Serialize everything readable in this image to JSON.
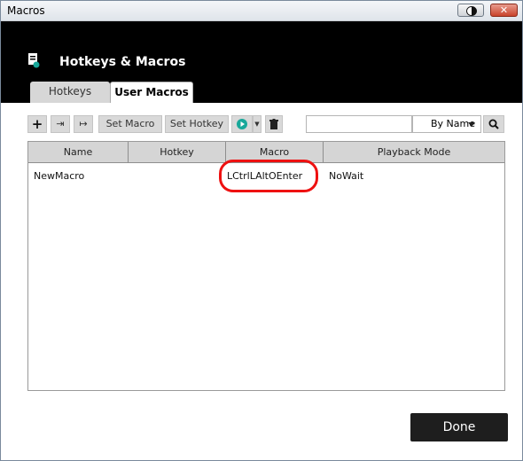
{
  "window": {
    "title": "Macros"
  },
  "header": {
    "title": "Hotkeys & Macros"
  },
  "tabs": [
    {
      "label": "Hotkeys",
      "active": false
    },
    {
      "label": "User Macros",
      "active": true
    }
  ],
  "toolbar": {
    "set_macro_label": "Set Macro",
    "set_hotkey_label": "Set Hotkey",
    "search_value": "",
    "sort_value": "By Name"
  },
  "table": {
    "columns": [
      "Name",
      "Hotkey",
      "Macro",
      "Playback Mode"
    ],
    "rows": [
      {
        "name": "NewMacro",
        "hotkey": "",
        "macro": "LCtrlLAltOEnter",
        "playback": "NoWait"
      }
    ]
  },
  "footer": {
    "done_label": "Done"
  },
  "colors": {
    "header_bg": "#000000",
    "highlight": "#ee1111",
    "done_bg": "#1e1e1e"
  }
}
